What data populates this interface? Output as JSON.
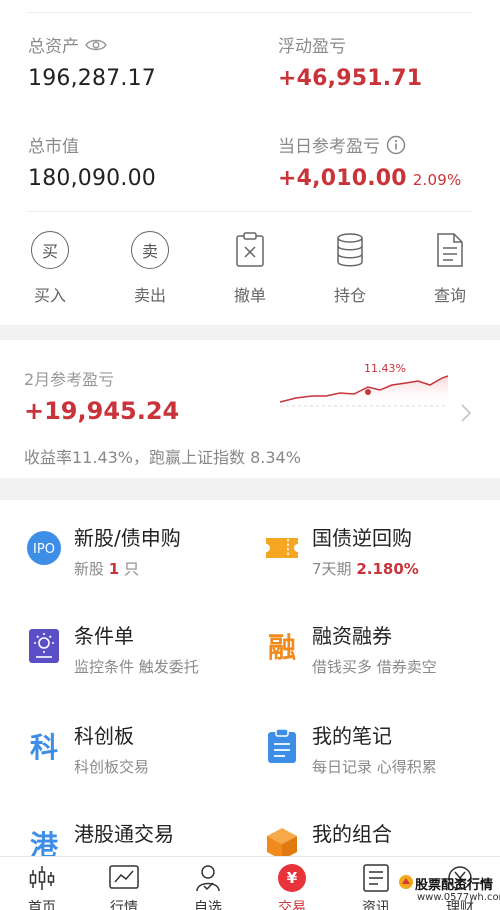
{
  "summary": {
    "total_assets_label": "总资产",
    "total_assets_value": "196,287.17",
    "floating_pl_label": "浮动盈亏",
    "floating_pl_value": "+46,951.71",
    "market_value_label": "总市值",
    "market_value_value": "180,090.00",
    "daily_pl_label": "当日参考盈亏",
    "daily_pl_value": "+4,010.00",
    "daily_pl_pct": "2.09%"
  },
  "actions": [
    {
      "label": "买入",
      "glyph": "买",
      "icon": "buy-circle-icon"
    },
    {
      "label": "卖出",
      "glyph": "卖",
      "icon": "sell-circle-icon"
    },
    {
      "label": "撤单",
      "icon": "cancel-order-icon"
    },
    {
      "label": "持仓",
      "icon": "holdings-stack-icon"
    },
    {
      "label": "查询",
      "icon": "query-document-icon"
    }
  ],
  "monthly": {
    "label": "2月参考盈亏",
    "value": "+19,945.24",
    "desc": "收益率11.43%，跑赢上证指数 8.34%",
    "peak_label": "11.43%"
  },
  "grid": [
    {
      "title": "新股/债申购",
      "sub_prefix": "新股 ",
      "sub_highlight": "1",
      "sub_suffix": " 只",
      "icon": "ipo-icon",
      "icon_text": "IPO",
      "color": "#3d8ee6"
    },
    {
      "title": "国债逆回购",
      "sub_prefix": "7天期 ",
      "sub_highlight": "2.180%",
      "sub_suffix": "",
      "icon": "ticket-icon",
      "color": "#f5a623"
    },
    {
      "title": "条件单",
      "sub_prefix": "监控条件 触发委托",
      "sub_highlight": "",
      "sub_suffix": "",
      "icon": "condition-order-icon",
      "color": "#5b4fc7"
    },
    {
      "title": "融资融券",
      "sub_prefix": "借钱买多 借券卖空",
      "sub_highlight": "",
      "sub_suffix": "",
      "icon": "margin-trading-icon",
      "icon_text": "融",
      "color": "#f08a1c"
    },
    {
      "title": "科创板",
      "sub_prefix": "科创板交易",
      "sub_highlight": "",
      "sub_suffix": "",
      "icon": "star-market-icon",
      "icon_text": "科",
      "color": "#3d8ee6"
    },
    {
      "title": "我的笔记",
      "sub_prefix": "每日记录 心得积累",
      "sub_highlight": "",
      "sub_suffix": "",
      "icon": "notes-clipboard-icon",
      "color": "#3d8ee6"
    },
    {
      "title": "港股通交易",
      "sub_prefix": "",
      "sub_highlight": "",
      "sub_suffix": "",
      "icon": "hk-connect-icon",
      "icon_text": "港",
      "color": "#3d8ee6"
    },
    {
      "title": "我的组合",
      "sub_prefix": "",
      "sub_highlight": "",
      "sub_suffix": "",
      "icon": "portfolio-box-icon",
      "color": "#f08a1c"
    }
  ],
  "nav": [
    {
      "label": "首页",
      "icon": "home-candles-icon"
    },
    {
      "label": "行情",
      "icon": "market-chart-icon"
    },
    {
      "label": "自选",
      "icon": "watchlist-person-icon"
    },
    {
      "label": "交易",
      "icon": "trade-yen-icon",
      "glyph": "¥",
      "active": true
    },
    {
      "label": "资讯",
      "icon": "news-doc-icon"
    },
    {
      "label": "理财",
      "icon": "finance-icon"
    }
  ],
  "watermark": {
    "text": "股票配资行情",
    "url": "www.0577wh.com"
  },
  "colors": {
    "accent_red": "#c8343a",
    "label_grey": "#8a8a8a"
  }
}
